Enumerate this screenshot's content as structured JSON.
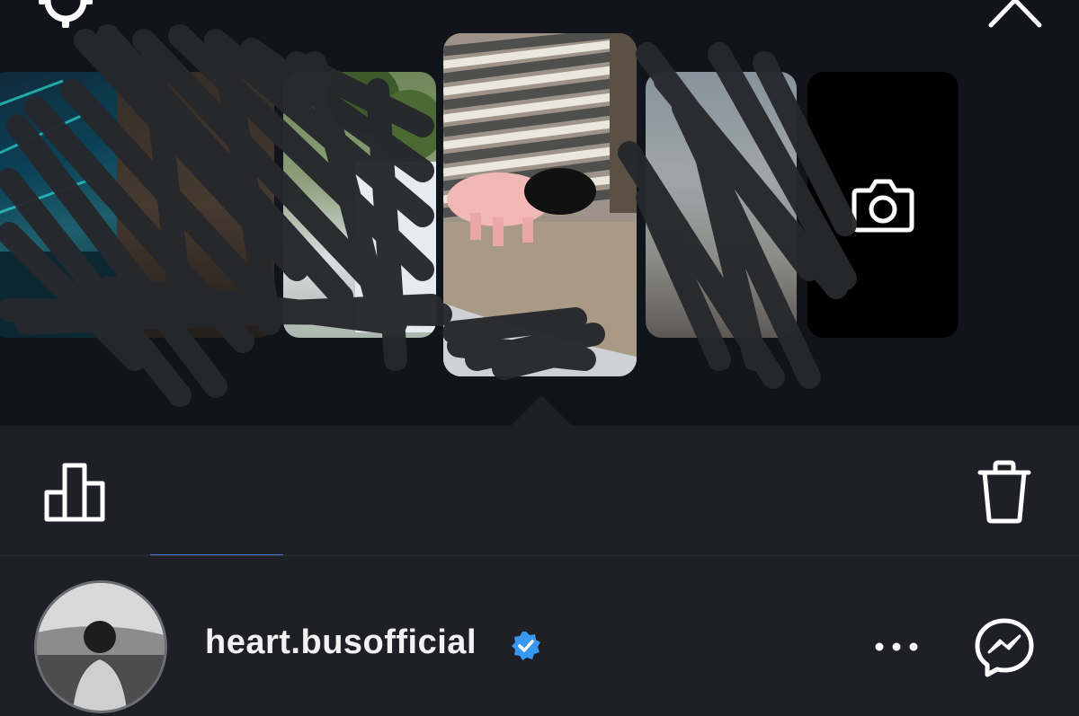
{
  "story_viewer": {
    "thumbnails": [
      {
        "name": "story-thumbnail-1"
      },
      {
        "name": "story-thumbnail-2"
      },
      {
        "name": "story-thumbnail-3"
      },
      {
        "name": "story-thumbnail-4",
        "selected": true
      },
      {
        "name": "story-thumbnail-5"
      },
      {
        "name": "add-story-camera"
      }
    ],
    "icons": {
      "settings": "gear-icon",
      "close": "close-icon",
      "camera": "camera-icon",
      "insights": "bar-chart-icon",
      "delete": "trash-icon",
      "more": "more-icon",
      "share": "messenger-icon",
      "verified": "verified-badge-icon"
    }
  },
  "account": {
    "username": "heart.busofficial",
    "verified": true
  },
  "colors": {
    "background_top": "#11151b",
    "panel": "#1e2026",
    "accent_tab": "#3f74d6",
    "verified": "#3897f0"
  }
}
